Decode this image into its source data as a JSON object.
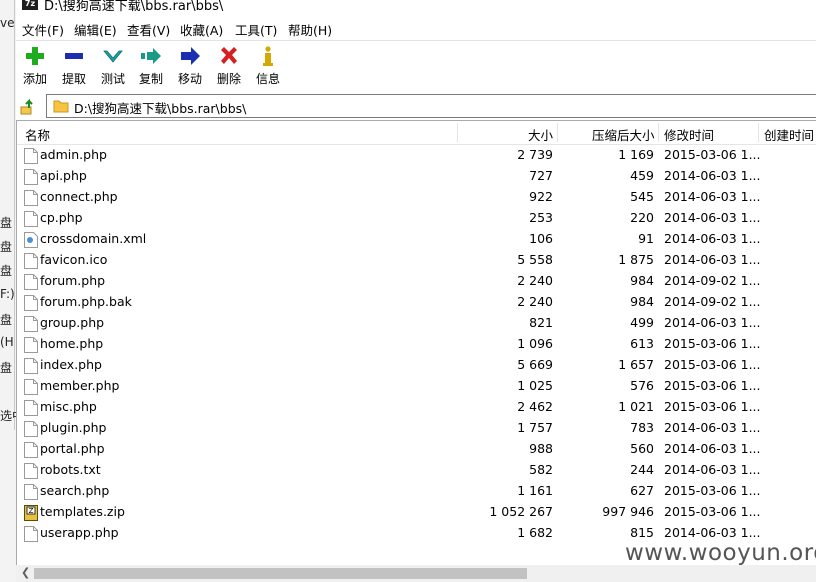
{
  "window": {
    "title": "D:\\搜狗高速下载\\bbs.rar\\bbs\\",
    "app_icon_text": "7z"
  },
  "left_fragments": [
    "ve",
    "盘",
    "盘",
    "盘",
    "F:)",
    "盘",
    "(H",
    "盘",
    "选中"
  ],
  "menu": [
    "文件(F)",
    "编辑(E)",
    "查看(V)",
    "收藏(A)",
    "工具(T)",
    "帮助(H)"
  ],
  "toolbar": [
    {
      "label": "添加",
      "icon": "plus-icon",
      "color": "#1faa1f"
    },
    {
      "label": "提取",
      "icon": "minus-icon",
      "color": "#1c2fb0"
    },
    {
      "label": "测试",
      "icon": "check-icon",
      "color": "#1aa3a3"
    },
    {
      "label": "复制",
      "icon": "copy-arrow-icon",
      "color": "#1a9a86"
    },
    {
      "label": "移动",
      "icon": "move-arrow-icon",
      "color": "#1c2fb0"
    },
    {
      "label": "删除",
      "icon": "delete-x-icon",
      "color": "#d42020"
    },
    {
      "label": "信息",
      "icon": "info-icon",
      "color": "#d4a800"
    }
  ],
  "address": {
    "path": "D:\\搜狗高速下载\\bbs.rar\\bbs\\"
  },
  "columns": {
    "name": "名称",
    "size": "大小",
    "packed": "压缩后大小",
    "modified": "修改时间",
    "created": "创建时间"
  },
  "files": [
    {
      "name": "admin.php",
      "size": "2 739",
      "packed": "1 169",
      "modified": "2015-03-06 1...",
      "type": "file"
    },
    {
      "name": "api.php",
      "size": "727",
      "packed": "459",
      "modified": "2014-06-03 1...",
      "type": "file"
    },
    {
      "name": "connect.php",
      "size": "922",
      "packed": "545",
      "modified": "2014-06-03 1...",
      "type": "file"
    },
    {
      "name": "cp.php",
      "size": "253",
      "packed": "220",
      "modified": "2014-06-03 1...",
      "type": "file"
    },
    {
      "name": "crossdomain.xml",
      "size": "106",
      "packed": "91",
      "modified": "2014-06-03 1...",
      "type": "xml"
    },
    {
      "name": "favicon.ico",
      "size": "5 558",
      "packed": "1 875",
      "modified": "2014-06-03 1...",
      "type": "file"
    },
    {
      "name": "forum.php",
      "size": "2 240",
      "packed": "984",
      "modified": "2014-09-02 1...",
      "type": "file"
    },
    {
      "name": "forum.php.bak",
      "size": "2 240",
      "packed": "984",
      "modified": "2014-09-02 1...",
      "type": "file"
    },
    {
      "name": "group.php",
      "size": "821",
      "packed": "499",
      "modified": "2014-06-03 1...",
      "type": "file"
    },
    {
      "name": "home.php",
      "size": "1 096",
      "packed": "613",
      "modified": "2015-03-06 1...",
      "type": "file"
    },
    {
      "name": "index.php",
      "size": "5 669",
      "packed": "1 657",
      "modified": "2015-03-06 1...",
      "type": "file"
    },
    {
      "name": "member.php",
      "size": "1 025",
      "packed": "576",
      "modified": "2015-03-06 1...",
      "type": "file"
    },
    {
      "name": "misc.php",
      "size": "2 462",
      "packed": "1 021",
      "modified": "2015-03-06 1...",
      "type": "file"
    },
    {
      "name": "plugin.php",
      "size": "1 757",
      "packed": "783",
      "modified": "2014-06-03 1...",
      "type": "file"
    },
    {
      "name": "portal.php",
      "size": "988",
      "packed": "560",
      "modified": "2014-06-03 1...",
      "type": "file"
    },
    {
      "name": "robots.txt",
      "size": "582",
      "packed": "244",
      "modified": "2014-06-03 1...",
      "type": "file"
    },
    {
      "name": "search.php",
      "size": "1 161",
      "packed": "627",
      "modified": "2015-03-06 1...",
      "type": "file"
    },
    {
      "name": "templates.zip",
      "size": "1 052 267",
      "packed": "997 946",
      "modified": "2015-03-06 1...",
      "type": "zip"
    },
    {
      "name": "userapp.php",
      "size": "1 682",
      "packed": "815",
      "modified": "2014-06-03 1...",
      "type": "file"
    }
  ],
  "watermark": "www.wooyun.org"
}
